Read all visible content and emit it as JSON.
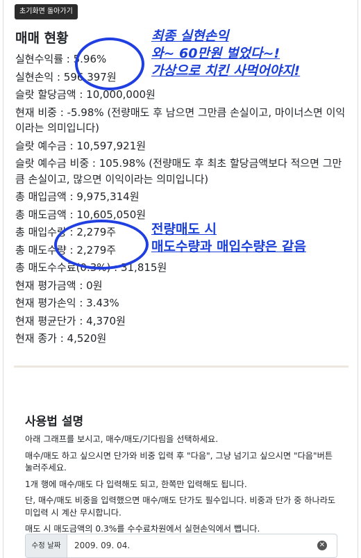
{
  "toolbar": {
    "back_label": "초기화면 돌아가기"
  },
  "title": "매매 현황",
  "stats": [
    "실현수익률 : 5.96%",
    "실현손익 : 596,397원",
    "슬랏 할당금액 : 10,000,000원",
    "현재 비중 : -5.98% (전량매도 후 남으면 그만큼 손실이고, 마이너스면 이익이라는 의미입니다)",
    "슬랏 예수금 : 10,597,921원",
    "슬랏 예수금 비중 : 105.98% (전량매도 후 최초 할당금액보다 적으면 그만큼 손실이고, 많으면 이익이라는 의미입니다)",
    "총 매입금액 : 9,975,314원",
    "총 매도금액 : 10,605,050원",
    "총 매입수량 : 2,279주",
    "총 매도수량 : 2,279주",
    "총 매도수수료(0.3%) : 31,815원",
    "현재 평가금액 : 0원",
    "현재 평가손익 : 3.43%",
    "현재 평균단가 : 4,370원",
    "현재 종가 : 4,520원"
  ],
  "annotations": {
    "top": [
      "최종 실현손익",
      "와~ 60만원 벌었다~!",
      "가상으로 치킨 사먹어야지!"
    ],
    "middle": [
      "전량매도 시",
      "매도수량과 매입수량은 같음"
    ]
  },
  "usage": {
    "title": "사용법 설명",
    "paragraphs": [
      "아래 그래프를 보시고, 매수/매도/기다림을 선택하세요.",
      "매수/매도 하고 싶으시면 단가와 비중 입력 후 \"다음\", 그냥 넘기고 싶으시면 \"다음\"버튼 눌러주세요.",
      "1개 행에 매수/매도 다 입력해도 되고, 한쪽만 입력해도 됩니다.",
      "단, 매수/매도 비중을 입력했으면 매수/매도 단가도 필수입니다. 비중과 단가 중 하나라도 미입력 시 계산 무시합니다.",
      "매도 시 매도금액의 0.3%를 수수료차원에서 실현손익에서 뺍니다."
    ]
  },
  "date_field": {
    "label": "수정 날짜",
    "value": "2009. 09. 04."
  },
  "colors": {
    "annotation": "#1a3fd8",
    "back_button_bg": "#2b2b2b",
    "divider": "#ece7df"
  }
}
